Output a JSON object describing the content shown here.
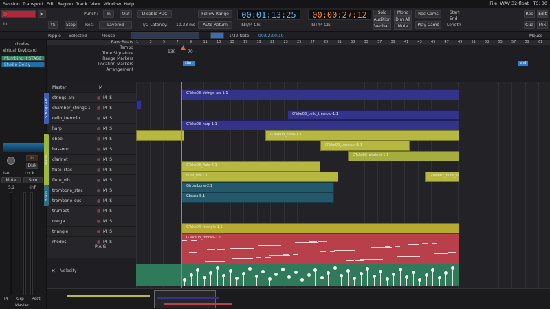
{
  "menubar": {
    "items": [
      "Session",
      "Transport",
      "Edit",
      "Region",
      "Track",
      "View",
      "Window",
      "Help"
    ],
    "file_info": "File: WAV 32-float",
    "tc": "TC: 30"
  },
  "toolbar": {
    "int_label": "Int.",
    "punch_label": "Punch:",
    "in_label": "In",
    "out_label": "Out",
    "disable_pdc": "Disable PDC",
    "follow_range": "Follow Range",
    "clock_primary": "00:01:13:25",
    "clock_secondary": "00:00:27:12",
    "ys_label": "YS",
    "stop_label": "Stop",
    "rec_label": "Rec:",
    "rec_mode": "Layered",
    "io_latency": "I/O Latency:",
    "latency_value": "10.33 ms",
    "auto_return": "Auto Return",
    "int_mclk": "INT/M-Clk",
    "int_mclk2": "INT/M-Clk",
    "solo_label": "Solo",
    "audition_label": "Audition",
    "feedback_label": "Feedback",
    "mono_label": "Mono",
    "dim_all_label": "Dim All",
    "mute_label": "Mute",
    "rec_cams": "Rec Cams",
    "play_cams": "Play Cams",
    "start_label": "Start",
    "end_label": "End",
    "length_label": "Length",
    "rec_btn": "Rec",
    "edit_btn": "Edit",
    "cue_btn": "Cue",
    "mix_btn": "Mix"
  },
  "editbar": {
    "ripple": "Ripple",
    "selected": "Selected",
    "mouse": "Mouse",
    "note": "1/32 Note",
    "nudge": "00:02:00:10",
    "mouse_right": "Mouse"
  },
  "leftpanel": {
    "plugin": "rhodes",
    "instrument": "Virtual Keyboard",
    "preset1": "Plumbing II STAGE",
    "preset2": "Studio Delay",
    "in_btn": "In",
    "disk_btn": "Disk",
    "iso": "Iso",
    "lock": "Lock",
    "mute": "Mute",
    "solo": "Solo",
    "gain1": "5.2",
    "gain2": "-inf",
    "bottom_m": "M",
    "bottom_grp": "Grp",
    "bottom_post": "Post",
    "bottom_master": "Master"
  },
  "rulers": {
    "names": [
      "Bars:Beats",
      "Tempo",
      "Time Signature",
      "Range Markers",
      "Location Markers",
      "Arrangement"
    ],
    "tempo1": "130",
    "tempo2": "70",
    "marker_start": "start",
    "marker_end": "end",
    "bar_numbers": [
      "1",
      "3",
      "5",
      "7",
      "9",
      "11",
      "13",
      "15",
      "17",
      "19",
      "21",
      "23",
      "25",
      "27",
      "29",
      "31",
      "33",
      "35",
      "37",
      "39",
      "41",
      "43",
      "45",
      "47",
      "49",
      "51",
      "53",
      "55",
      "57",
      "59",
      "61"
    ]
  },
  "tracks": {
    "header": "Master",
    "header_m": "M",
    "list": [
      {
        "name": "strings_arc"
      },
      {
        "name": "chamber_strings 1"
      },
      {
        "name": "cello_tremolo"
      },
      {
        "name": "harp"
      },
      {
        "name": "oboe"
      },
      {
        "name": "bassoon"
      },
      {
        "name": "clarinet"
      },
      {
        "name": "flute_stac"
      },
      {
        "name": "flute_vib"
      },
      {
        "name": "trombone_stac"
      },
      {
        "name": "trombone_sus"
      },
      {
        "name": "trumpet"
      },
      {
        "name": "conga"
      },
      {
        "name": "triangle"
      },
      {
        "name": "rhodes"
      }
    ],
    "m_label": "M",
    "s_label": "S",
    "p": "P",
    "a": "A",
    "g": "G",
    "velocity": "Velocity",
    "groups": [
      {
        "name": "Strings Arr",
        "color": "#3c5fb5"
      },
      {
        "name": "Winds",
        "color": "#9bb83a"
      },
      {
        "name": "Brass",
        "color": "#2c6f83"
      }
    ]
  },
  "regions": {
    "r1": "GTake03_strings_arc-1.1",
    "r2": "GTake03_cello_tremolo-1.1",
    "r3": "GTake03_harp-1.1",
    "r4": "GTake03_oboe-1.1",
    "r5": "GTake06_bassoon-1.1",
    "r6": "GTake06_clarinet-1.1",
    "r7": "GTake03_flute-4.1",
    "r8": "flute_vib-1.1",
    "r9": "GTake07_flute_vib",
    "r10": "Gtrombone-2.1",
    "r11": "Gbrass-5.1",
    "r12": "GTake04_triangle-1.1",
    "r13": "GTake03_rhodes-1.1"
  },
  "colors": {
    "strings": "#34338a",
    "winds": "#b7b841",
    "wind_dark": "#a5ad3d",
    "brass": "#23596a",
    "triangle": "#b6ab2f",
    "rhodes": "#b8404a",
    "velocity": "#2f7a5a",
    "playhead": "#e86a24"
  }
}
